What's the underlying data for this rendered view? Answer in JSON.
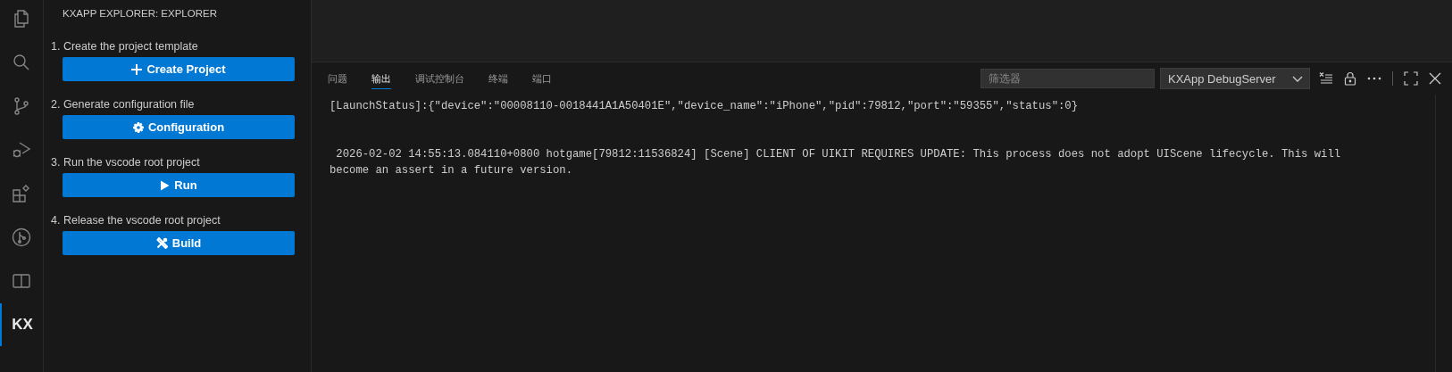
{
  "activity_bar": {
    "items": [
      {
        "kind": "files",
        "selected": false
      },
      {
        "kind": "search",
        "selected": false
      },
      {
        "kind": "source-control",
        "selected": false
      },
      {
        "kind": "run-debug",
        "selected": false
      },
      {
        "kind": "extensions",
        "selected": false
      },
      {
        "kind": "git-graph",
        "selected": false
      },
      {
        "kind": "book",
        "selected": false
      },
      {
        "kind": "text",
        "label": "KX",
        "selected": true
      }
    ]
  },
  "sidebar": {
    "title": "KXAPP EXPLORER: EXPLORER",
    "steps": [
      {
        "label": "1. Create the project template",
        "button": {
          "label": "Create Project",
          "kind": "plus"
        }
      },
      {
        "label": "2. Generate configuration file",
        "button": {
          "label": "Configuration",
          "kind": "gear"
        }
      },
      {
        "label": "3. Run the vscode root project",
        "button": {
          "label": "Run",
          "kind": "play"
        }
      },
      {
        "label": "4. Release the vscode root project",
        "button": {
          "label": "Build",
          "kind": "tools"
        }
      }
    ]
  },
  "panel": {
    "tabs": [
      {
        "label": "问题",
        "selected": false
      },
      {
        "label": "输出",
        "selected": true
      },
      {
        "label": "调试控制台",
        "selected": false
      },
      {
        "label": "终端",
        "selected": false
      },
      {
        "label": "端口",
        "selected": false
      }
    ],
    "filter": {
      "placeholder": "筛选器"
    },
    "channel": {
      "value": "KXApp DebugServer"
    },
    "output": [
      {
        "kind": "line",
        "text": "[LaunchStatus]:{\"device\":\"00008110-0018441A1A50401E\",\"device_name\":\"iPhone\",\"pid\":79812,\"port\":\"59355\",\"status\":0}"
      },
      {
        "kind": "blank"
      },
      {
        "kind": "blank"
      },
      {
        "kind": "line",
        "text": " 2026-02-02 14:55:13.084110+0800 hotgame[79812:11536824] [Scene] CLIENT OF UIKIT REQUIRES UPDATE: This process does not adopt UIScene lifecycle. This will become an assert in a future version."
      }
    ]
  }
}
